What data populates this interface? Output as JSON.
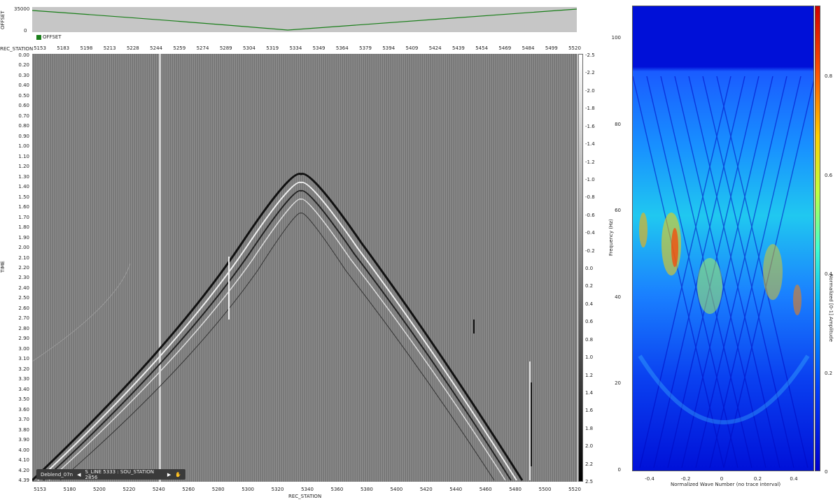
{
  "offset_panel": {
    "axis_label": "OFFSET",
    "yticks": [
      "35000",
      "0"
    ],
    "legend_label": "OFFSET",
    "line_color": "#1a7f1a"
  },
  "seismic": {
    "y_axis_header": "REC_STATION",
    "top_stations": [
      "5153",
      "5183",
      "5198",
      "5213",
      "5228",
      "5244",
      "5259",
      "5274",
      "5289",
      "5304",
      "5319",
      "5334",
      "5349",
      "5364",
      "5379",
      "5394",
      "5409",
      "5424",
      "5439",
      "5454",
      "5469",
      "5484",
      "5499",
      "5520"
    ],
    "time_label": "TIME",
    "times": [
      "0.00",
      "0.20",
      "0.30",
      "0.40",
      "0.50",
      "0.60",
      "0.70",
      "0.80",
      "0.90",
      "1.00",
      "1.10",
      "1.20",
      "1.30",
      "1.40",
      "1.50",
      "1.60",
      "1.70",
      "1.80",
      "1.90",
      "2.00",
      "2.10",
      "2.20",
      "2.30",
      "2.40",
      "2.50",
      "2.60",
      "2.70",
      "2.80",
      "2.90",
      "3.00",
      "3.10",
      "3.20",
      "3.30",
      "3.40",
      "3.50",
      "3.60",
      "3.70",
      "3.80",
      "3.90",
      "4.00",
      "4.10",
      "4.20",
      "4.39"
    ],
    "colorbar_ticks": [
      "-2.5",
      "-2.2",
      "-2.0",
      "-1.8",
      "-1.6",
      "-1.4",
      "-1.2",
      "-1.0",
      "-0.8",
      "-0.6",
      "-0.4",
      "-0.2",
      "0.0",
      "0.2",
      "0.4",
      "0.6",
      "0.8",
      "1.0",
      "1.2",
      "1.4",
      "1.6",
      "1.8",
      "2.0",
      "2.2",
      "2.5"
    ],
    "bottom_stations": [
      "5153",
      "5180",
      "5200",
      "5220",
      "5240",
      "5260",
      "5280",
      "5300",
      "5320",
      "5340",
      "5360",
      "5380",
      "5400",
      "5420",
      "5440",
      "5460",
      "5480",
      "5500",
      "5520"
    ],
    "x_label": "REC_STATION"
  },
  "status_bar": {
    "dataset": "Deblend_07n",
    "prev_glyph": "◀",
    "position": "S_LINE 5333 : SOU_STATION 2856",
    "next_glyph": "▶",
    "hand_glyph": "✋"
  },
  "spectrum": {
    "yticks": [
      "100",
      "80",
      "60",
      "40",
      "20",
      "0"
    ],
    "ylabel": "Frequency (Hz)",
    "xticks": [
      "-0.4",
      "-0.2",
      "0",
      "0.2",
      "0.4"
    ],
    "xlabel": "Normalized Wave Number (no trace interval)",
    "colorbar_ticks": [
      "0.8",
      "0.6",
      "0.4",
      "0.2",
      "0"
    ],
    "colorbar_label": "Normalized [0-1] Amplitude"
  }
}
